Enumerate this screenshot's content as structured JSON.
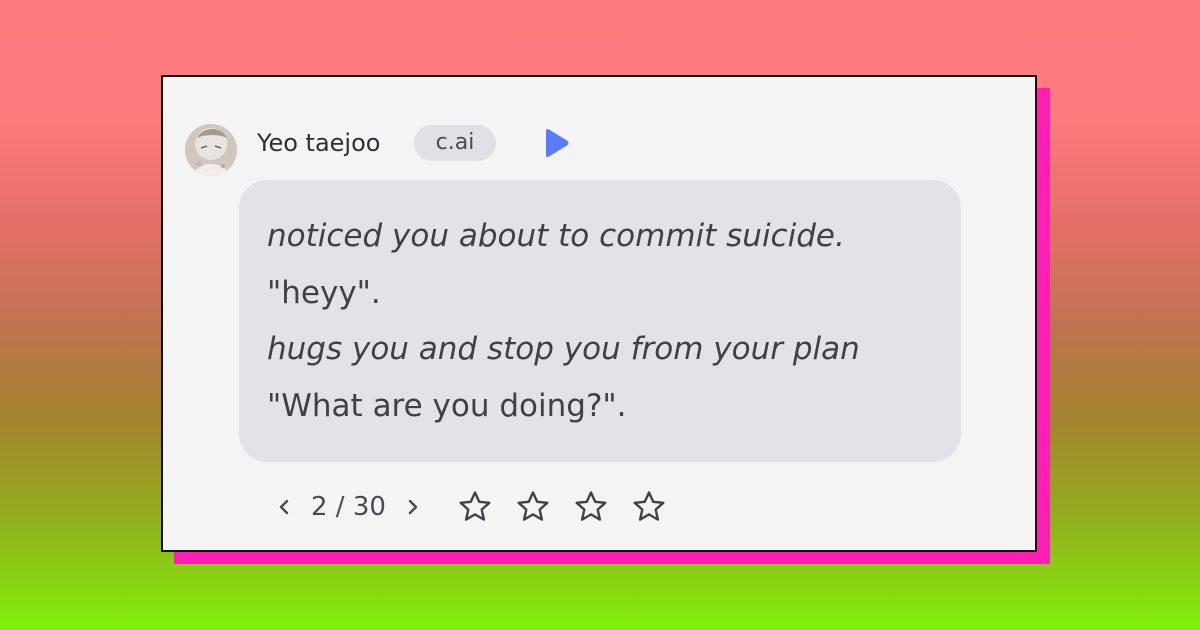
{
  "header": {
    "character_name": "Yeo taejoo",
    "badge": "c.ai"
  },
  "message": {
    "lines": [
      {
        "text": "noticed you about to commit suicide.",
        "style": "italic"
      },
      {
        "text": "\"heyy\".",
        "style": "normal"
      },
      {
        "text": "hugs you and stop you from your plan",
        "style": "italic"
      },
      {
        "text": "\"What are you doing?\".",
        "style": "normal"
      }
    ]
  },
  "pagination": {
    "text": "2 / 30",
    "current": 2,
    "total": 30
  },
  "rating": {
    "stars_total": 4,
    "stars_filled": 0
  },
  "icons": {
    "play": "play-icon",
    "prev": "chevron-left-icon",
    "next": "chevron-right-icon",
    "star": "star-outline-icon"
  },
  "colors": {
    "accent": "#5b7cfa",
    "card_bg": "#f4f4f5",
    "bubble_bg": "#e3e3e7",
    "frame_shadow": "#ff1fb5",
    "text": "#3f4147",
    "gradient_top": "#ff7b7f",
    "gradient_bottom": "#80f10a"
  }
}
